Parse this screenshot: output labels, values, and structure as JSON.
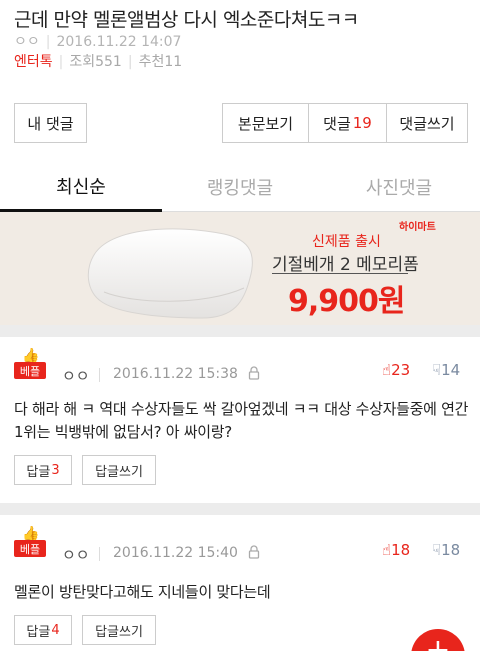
{
  "post": {
    "title": "근데 만약 멜론앨범상 다시 엑소준다쳐도ㅋㅋ",
    "author": "ㅇㅇ",
    "datetime": "2016.11.22 14:07",
    "category": "엔터톡",
    "views": "조회551",
    "recommends": "추천11"
  },
  "actions": {
    "my_comments": "내 댓글",
    "view_body": "본문보기",
    "comments_label": "댓글",
    "comments_count": "19",
    "write_comment": "댓글쓰기"
  },
  "tabs": [
    {
      "label": "최신순",
      "active": true
    },
    {
      "label": "랭킹댓글",
      "active": false
    },
    {
      "label": "사진댓글",
      "active": false
    }
  ],
  "ad": {
    "brand": "하이마트",
    "line1": "신제품 출시",
    "line2": "기절베개 2 메모리폼",
    "price": "9,900원"
  },
  "comments": [
    {
      "badge": "베플",
      "author": "ㅇㅇ",
      "datetime": "2016.11.22 15:38",
      "up": "23",
      "down": "14",
      "text": "다 해라 해 ㅋ 역대 수상자들도 싹 갈아엎겠네 ㅋㅋ 대상 수상자들중에 연간 1위는 빅뱅밖에 없담서? 아 싸이랑?",
      "reply_label": "답글",
      "reply_count": "3",
      "write_reply": "답글쓰기"
    },
    {
      "badge": "베플",
      "author": "ㅇㅇ",
      "datetime": "2016.11.22 15:40",
      "up": "18",
      "down": "18",
      "text": "멜론이 방탄맞다고해도 지네들이 맞다는데",
      "reply_label": "답글",
      "reply_count": "4",
      "write_reply": "답글쓰기"
    }
  ],
  "fab": {
    "icon": "plus-icon",
    "glyph": "+"
  },
  "colors": {
    "accent": "#e8251c",
    "down": "#7a8aa0",
    "banner_bg": "#f1ebe4"
  }
}
